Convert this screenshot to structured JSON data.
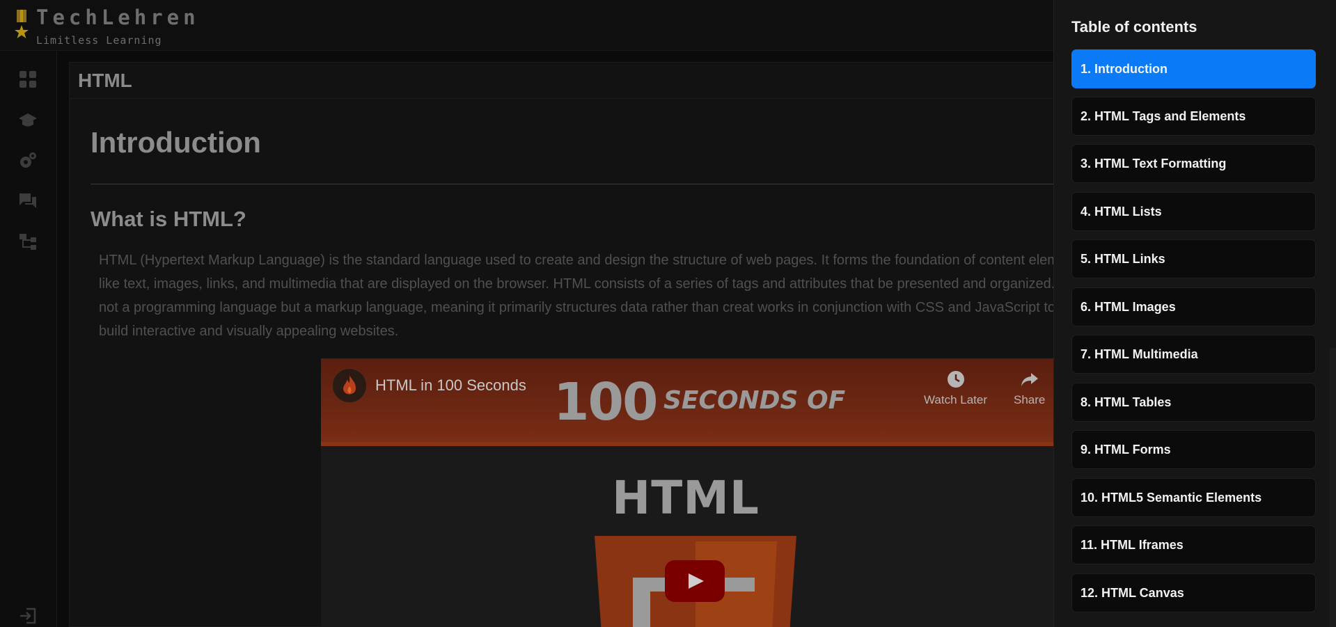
{
  "brand": {
    "title": "TechLehren",
    "subtitle": "Limitless Learning",
    "accent": "#b8960c"
  },
  "sidebar": {
    "items": [
      {
        "icon": "dashboard-grid-icon"
      },
      {
        "icon": "graduation-cap-icon"
      },
      {
        "icon": "gears-icon"
      },
      {
        "icon": "chat-bubbles-icon"
      },
      {
        "icon": "hierarchy-tree-icon"
      }
    ],
    "bottom_icon": "logout-icon"
  },
  "main": {
    "header": "HTML",
    "page_title": "Introduction",
    "section_heading": "What is HTML?",
    "paragraph": "HTML (Hypertext Markup Language) is the standard language used to create and design the structure of web pages. It forms the foundation of content elements like text, images, links, and multimedia that are displayed on the browser. HTML consists of a series of tags and attributes that be presented and organized. It is not a programming language but a markup language, meaning it primarily structures data rather than creat works in conjunction with CSS and JavaScript to build interactive and visually appealing websites.",
    "video": {
      "title": "HTML in 100 Seconds",
      "thumbnail_big": "100",
      "thumbnail_small": "SECONDS OF",
      "thumbnail_word": "HTML",
      "watch_later": "Watch Later",
      "share": "Share"
    }
  },
  "toc": {
    "title": "Table of contents",
    "active_color": "#0b7af7",
    "items": [
      {
        "label": "1. Introduction",
        "active": true
      },
      {
        "label": "2. HTML Tags and Elements",
        "active": false
      },
      {
        "label": "3. HTML Text Formatting",
        "active": false
      },
      {
        "label": "4. HTML Lists",
        "active": false
      },
      {
        "label": "5. HTML Links",
        "active": false
      },
      {
        "label": "6. HTML Images",
        "active": false
      },
      {
        "label": "7. HTML Multimedia",
        "active": false
      },
      {
        "label": "8. HTML Tables",
        "active": false
      },
      {
        "label": "9. HTML Forms",
        "active": false
      },
      {
        "label": "10. HTML5 Semantic Elements",
        "active": false
      },
      {
        "label": "11. HTML Iframes",
        "active": false
      },
      {
        "label": "12. HTML Canvas",
        "active": false
      }
    ]
  }
}
